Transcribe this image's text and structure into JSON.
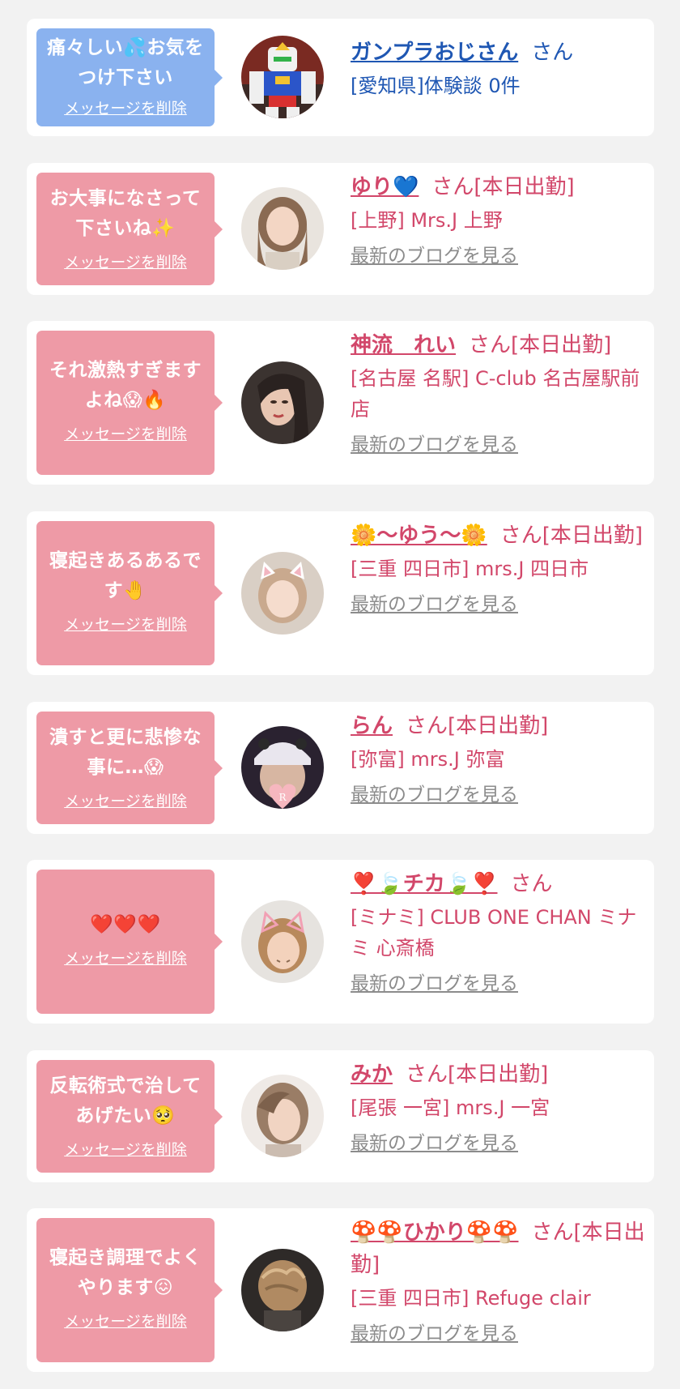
{
  "colors": {
    "page_bg": "#f2f2f2",
    "card_bg": "#ffffff",
    "bubble_blue": "#8ab2ef",
    "bubble_pink": "#ee9aa6",
    "text_pink": "#d2476a",
    "text_blue": "#1f57b3",
    "link_gray": "#8c8c8c"
  },
  "delete_label": "メッセージを削除",
  "blog_label": "最新のブログを見る",
  "items": [
    {
      "message_lines": [
        "痛々しい💦お気を",
        "つけ下さい"
      ],
      "name": "ガンプラおじさん",
      "suffix": "さん",
      "shop": "[愛知県]体験談 0件",
      "blog": "",
      "avatar_icon": "gundam-avatar"
    },
    {
      "message_lines": [
        "お大事になさって",
        "下さいね✨"
      ],
      "name": "ゆり💙",
      "suffix": "さん[本日出勤]",
      "shop": "[上野] Mrs.J 上野",
      "blog": "最新のブログを見る",
      "avatar_icon": "woman-avatar"
    },
    {
      "message_lines": [
        "それ激熱すぎます",
        "よね😱🔥"
      ],
      "name": "神流　れい",
      "suffix": "さん[本日出勤]",
      "shop": "[名古屋 名駅] C-club 名古屋駅前店",
      "blog": "最新のブログを見る",
      "avatar_icon": "woman-avatar"
    },
    {
      "message_lines": [
        "寝起きあるあるで",
        "す🤚"
      ],
      "name": "🌼〜ゆう〜🌼",
      "suffix": "さん[本日出勤]",
      "shop": "[三重 四日市] mrs.J 四日市",
      "blog": "最新のブログを見る",
      "avatar_icon": "cat-ears-avatar"
    },
    {
      "message_lines": [
        "潰すと更に悲惨な",
        "事に…😱"
      ],
      "name": "らん",
      "suffix": "さん[本日出勤]",
      "shop": "[弥富] mrs.J 弥富",
      "blog": "最新のブログを見る",
      "avatar_icon": "hat-avatar"
    },
    {
      "message_lines": [
        "❤️❤️❤️"
      ],
      "name": "❣️🍃チカ🍃❣️",
      "suffix": "さん",
      "shop": "[ミナミ] CLUB ONE CHAN ミナミ 心斎橋",
      "blog": "最新のブログを見る",
      "avatar_icon": "cat-ears-avatar"
    },
    {
      "message_lines": [
        "反転術式で治して",
        "あげたい🥺"
      ],
      "name": "みか",
      "suffix": "さん[本日出勤]",
      "shop": "[尾張 一宮] mrs.J 一宮",
      "blog": "最新のブログを見る",
      "avatar_icon": "woman-avatar"
    },
    {
      "message_lines": [
        "寝起き調理でよく",
        "やります😖"
      ],
      "name": "🍄🍄ひかり🍄🍄",
      "suffix": "さん[本日出勤]",
      "shop": "[三重 四日市] Refuge clair",
      "blog": "最新のブログを見る",
      "avatar_icon": "back-of-head-avatar"
    }
  ]
}
